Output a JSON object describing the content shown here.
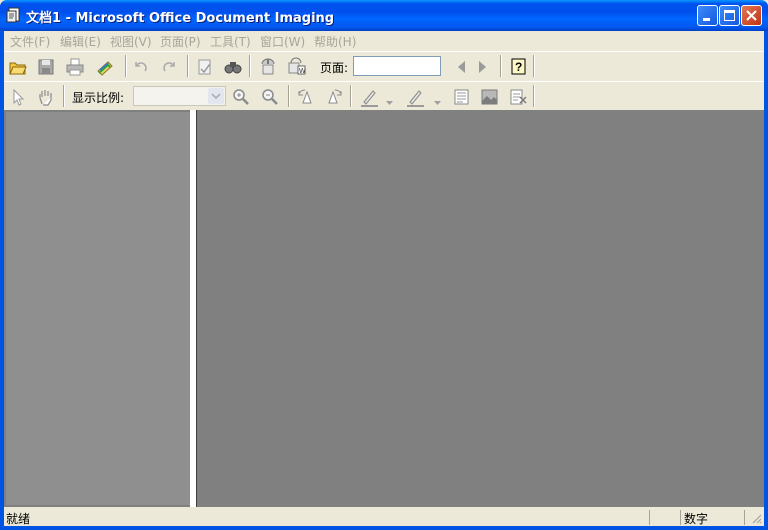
{
  "window": {
    "title": "文档1 - Microsoft Office Document Imaging",
    "icon": "document-imaging-icon"
  },
  "menu": [
    {
      "label": "文件(F)"
    },
    {
      "label": "编辑(E)"
    },
    {
      "label": "视图(V)"
    },
    {
      "label": "页面(P)"
    },
    {
      "label": "工具(T)"
    },
    {
      "label": "窗口(W)"
    },
    {
      "label": "帮助(H)"
    }
  ],
  "toolbar1": {
    "buttons": [
      "open-icon",
      "save-icon",
      "print-icon",
      "send-icon",
      "undo-icon",
      "redo-icon",
      "recognize-text-icon",
      "find-icon",
      "send-text-to-word-icon",
      "export-icon",
      "help-icon"
    ],
    "page_label": "页面:",
    "page_value": ""
  },
  "toolbar2": {
    "buttons": [
      "select-pointer-icon",
      "pan-hand-icon",
      "zoom-in-icon",
      "zoom-out-icon",
      "rotate-left-icon",
      "rotate-right-icon",
      "pen-icon",
      "highlighter-icon",
      "text-box-icon",
      "picture-icon",
      "annotation-icon"
    ],
    "zoom_label": "显示比例:",
    "zoom_value": ""
  },
  "status": {
    "text": "就绪",
    "mode": "数字"
  }
}
